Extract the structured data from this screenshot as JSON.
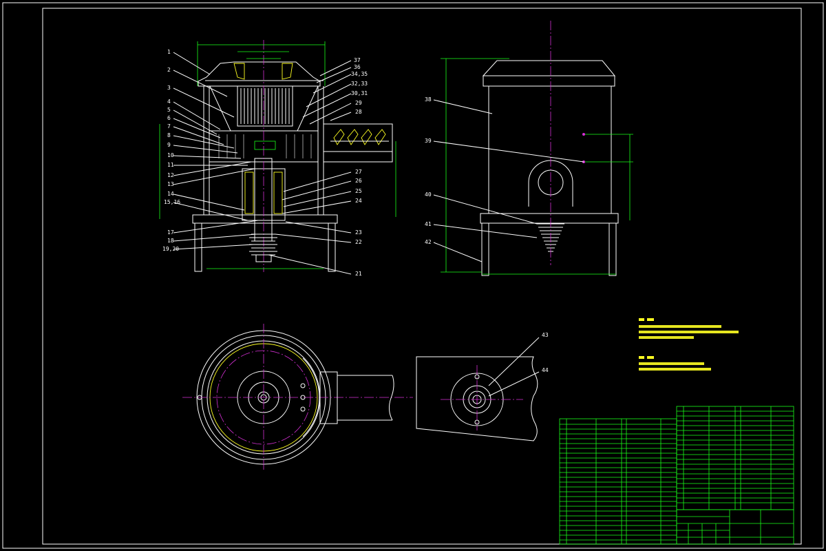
{
  "part_labels_left": [
    "1",
    "2",
    "3",
    "4",
    "5",
    "6",
    "7",
    "8",
    "9",
    "10",
    "11",
    "12",
    "13",
    "14",
    "15,16",
    "17",
    "18",
    "19,20",
    "37",
    "36",
    "34,35",
    "32,33",
    "30,31",
    "29",
    "28",
    "27",
    "26",
    "25",
    "24",
    "23",
    "22",
    "21"
  ],
  "part_labels_right": [
    "38",
    "39",
    "40",
    "41",
    "42"
  ],
  "part_labels_bottom": [
    "43",
    "44"
  ],
  "colors": {
    "background": "#000000",
    "outline": "#ffffff",
    "dimension": "#19ff19",
    "centerline": "#d430d4",
    "hatch": "#ffff22",
    "leader": "#ffffff"
  }
}
